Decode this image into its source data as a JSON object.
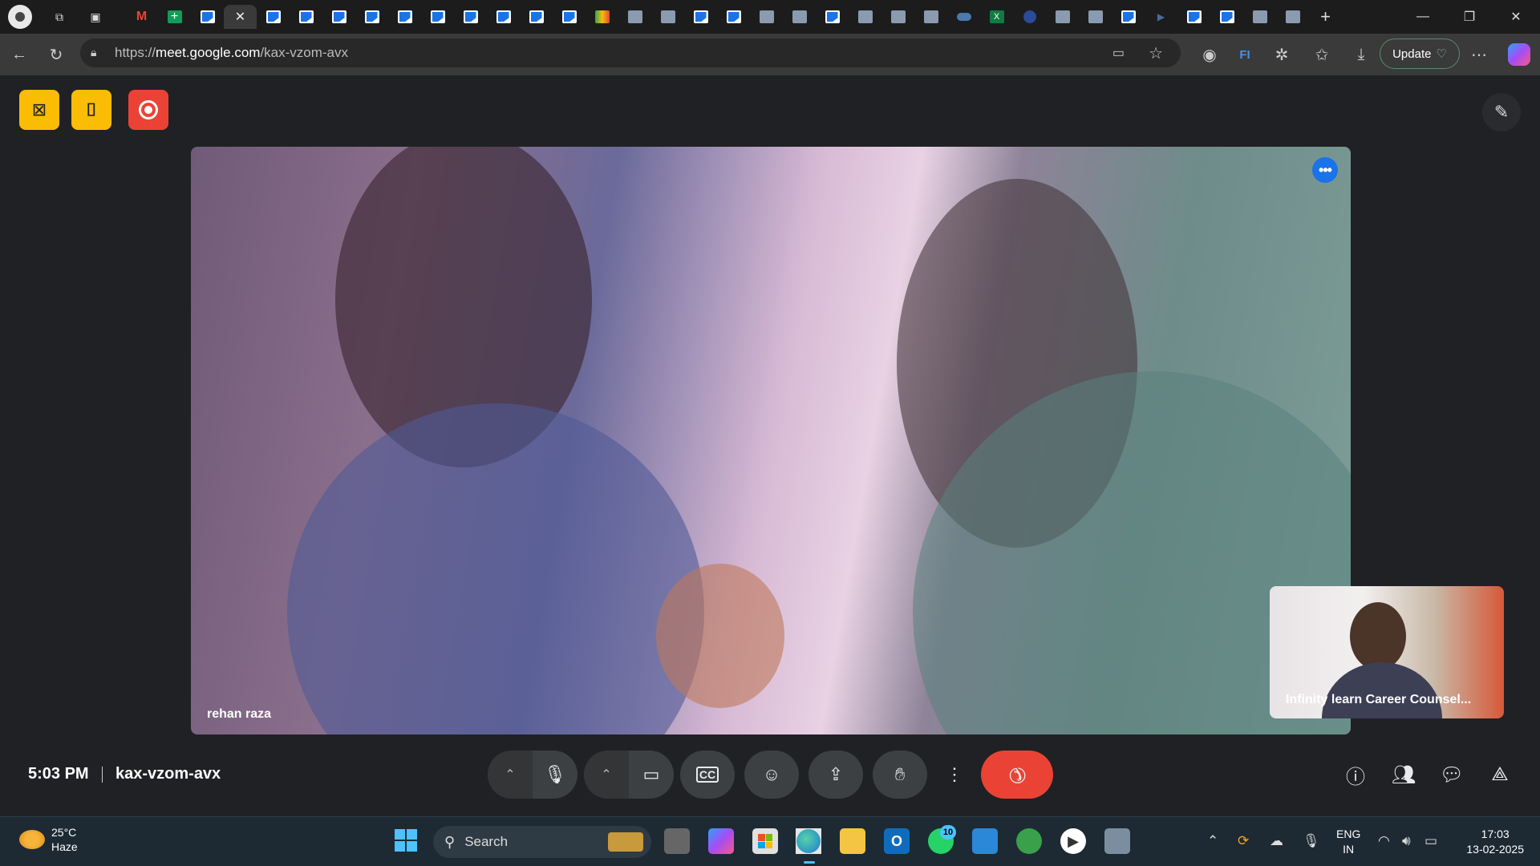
{
  "browser": {
    "url_prefix": "https://",
    "url_host": "meet.google.com",
    "url_path": "/kax-vzom-avx",
    "update_label": "Update"
  },
  "meet": {
    "main_participant_name": "rehan raza",
    "self_view_name": "Infinity learn Career Counsel...",
    "time": "5:03 PM",
    "meeting_code": "kax-vzom-avx",
    "participant_count": "2",
    "colors": {
      "end_call": "#ea4335",
      "accent": "#1a73e8",
      "host_control": "#fbbc04",
      "record": "#ea4335"
    }
  },
  "taskbar": {
    "weather_temp": "25°C",
    "weather_desc": "Haze",
    "search_label": "Search",
    "whatsapp_badge": "10",
    "lang_line1": "ENG",
    "lang_line2": "IN",
    "clock_time": "17:03",
    "clock_date": "13-02-2025"
  }
}
